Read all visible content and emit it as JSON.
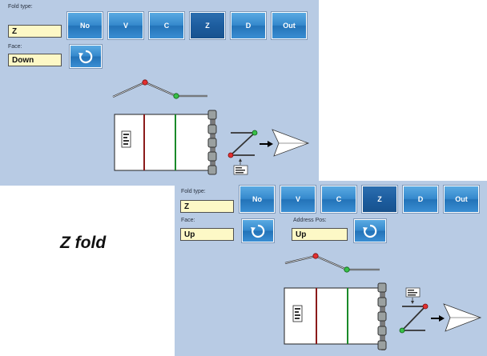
{
  "panel_top": {
    "fold_type_label": "Fold type:",
    "fold_type_value": "Z",
    "face_label": "Face:",
    "face_value": "Down",
    "fold_buttons": [
      {
        "label": "No",
        "selected": false
      },
      {
        "label": "V",
        "selected": false
      },
      {
        "label": "C",
        "selected": false
      },
      {
        "label": "Z",
        "selected": true
      },
      {
        "label": "D",
        "selected": false
      },
      {
        "label": "Out",
        "selected": false
      }
    ]
  },
  "panel_bottom": {
    "fold_type_label": "Fold type:",
    "fold_type_value": "Z",
    "face_label": "Face:",
    "face_value": "Up",
    "address_pos_label": "Address Pos:",
    "address_pos_value": "Up",
    "fold_buttons": [
      {
        "label": "No",
        "selected": false
      },
      {
        "label": "V",
        "selected": false
      },
      {
        "label": "C",
        "selected": false
      },
      {
        "label": "Z",
        "selected": true
      },
      {
        "label": "D",
        "selected": false
      },
      {
        "label": "Out",
        "selected": false
      }
    ]
  },
  "caption": "Z fold",
  "colors": {
    "panel_bg": "#b8cbe4",
    "field_bg": "#fdf8c6",
    "button_blue": "#3589cd",
    "button_selected": "#1d5d9f",
    "fold_red": "#8b1a1a",
    "fold_green": "#1a8a2a"
  },
  "icons": [
    "rotate-icon",
    "fold-profile-icon",
    "roller-icon",
    "arrow-right-icon",
    "paper-plane-icon",
    "address-card-icon"
  ]
}
